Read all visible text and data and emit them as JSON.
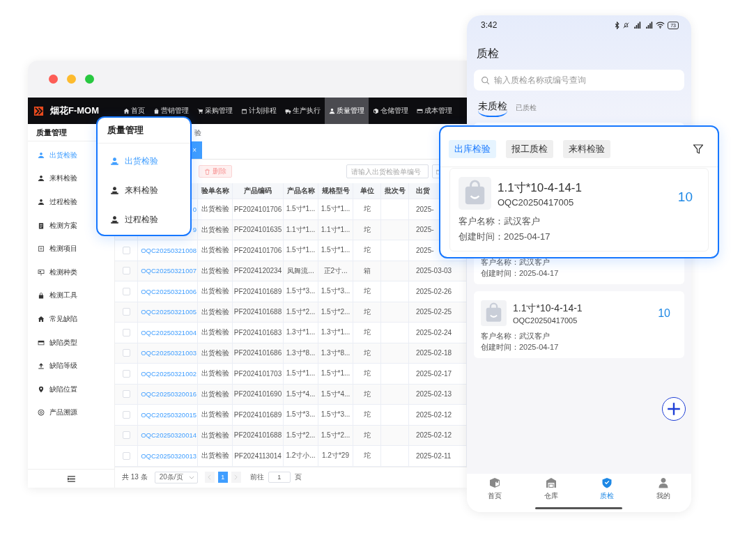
{
  "desktop": {
    "logo": "烟花F-MOM",
    "nav": [
      {
        "label": "首页",
        "kind": "home",
        "selected": false
      },
      {
        "label": "营销管理",
        "kind": "bag",
        "selected": false
      },
      {
        "label": "采购管理",
        "kind": "cart",
        "selected": false
      },
      {
        "label": "计划排程",
        "kind": "calendar",
        "selected": false
      },
      {
        "label": "生产执行",
        "kind": "truck",
        "selected": false
      },
      {
        "label": "质量管理",
        "kind": "user",
        "selected": true
      },
      {
        "label": "仓储管理",
        "kind": "box",
        "selected": false
      },
      {
        "label": "成本管理",
        "kind": "card",
        "selected": false
      }
    ],
    "sidebar": {
      "title": "质量管理",
      "items": [
        {
          "label": "出货检验",
          "kind": "user",
          "selected": true
        },
        {
          "label": "来料检验",
          "kind": "user",
          "selected": false
        },
        {
          "label": "过程检验",
          "kind": "user",
          "selected": false
        },
        {
          "label": "检测方案",
          "kind": "clipboard",
          "selected": false
        },
        {
          "label": "检测项目",
          "kind": "document",
          "selected": false
        },
        {
          "label": "检测种类",
          "kind": "easel",
          "selected": false
        },
        {
          "label": "检测工具",
          "kind": "lock",
          "selected": false
        },
        {
          "label": "常见缺陷",
          "kind": "home",
          "selected": false
        },
        {
          "label": "缺陷类型",
          "kind": "card",
          "selected": false
        },
        {
          "label": "缺陷等级",
          "kind": "upload",
          "selected": false
        },
        {
          "label": "缺陷位置",
          "kind": "pin",
          "selected": false
        },
        {
          "label": "产品溯源",
          "kind": "compass",
          "selected": false
        }
      ]
    },
    "breadcrumb": "验",
    "tabs": [
      {
        "close": "×",
        "selected": true
      }
    ],
    "toolbar": {
      "delete": "删除",
      "search_placeholder": "请输入出货检验单编号"
    },
    "table": {
      "columns": [
        "验单名称",
        "产品编码",
        "产品名称",
        "规格型号",
        "单位",
        "批次号",
        "出货"
      ],
      "rows": [
        {
          "code": "0",
          "name": "出货检验",
          "product_code": "PF2024101706",
          "product_name": "1.5寸*1...",
          "spec": "1.5寸*1...",
          "unit": "坨",
          "date": "2025-"
        },
        {
          "code": "9",
          "name": "出货检验",
          "product_code": "PF2024101635",
          "product_name": "1.1寸*1...",
          "spec": "1.1寸*1...",
          "unit": "坨",
          "date": "2025-"
        },
        {
          "checked": false,
          "code": "OQC20250321008",
          "name": "出货检验",
          "product_code": "PF2024101706",
          "product_name": "1.5寸*1...",
          "spec": "1.5寸*1...",
          "unit": "坨",
          "date": "2025-"
        },
        {
          "checked": false,
          "code": "OQC20250321007",
          "name": "出货检验",
          "product_code": "PF2024120234",
          "product_name": "凤舞流...",
          "spec": "正2寸...",
          "unit": "箱",
          "date": "2025-03-03"
        },
        {
          "checked": false,
          "code": "OQC20250321006",
          "name": "出货检验",
          "product_code": "PF2024101689",
          "product_name": "1.5寸*3...",
          "spec": "1.5寸*3...",
          "unit": "坨",
          "date": "2025-02-26"
        },
        {
          "checked": false,
          "code": "OQC20250321005",
          "name": "出货检验",
          "product_code": "PF2024101688",
          "product_name": "1.5寸*2...",
          "spec": "1.5寸*2...",
          "unit": "坨",
          "date": "2025-02-25"
        },
        {
          "checked": false,
          "code": "OQC20250321004",
          "name": "出货检验",
          "product_code": "PF2024101683",
          "product_name": "1.3寸*1...",
          "spec": "1.3寸*1...",
          "unit": "坨",
          "date": "2025-02-24"
        },
        {
          "checked": false,
          "code": "OQC20250321003",
          "name": "出货检验",
          "product_code": "PF2024101686",
          "product_name": "1.3寸*8...",
          "spec": "1.3寸*8...",
          "unit": "坨",
          "date": "2025-02-18"
        },
        {
          "checked": false,
          "code": "OQC20250321002",
          "name": "出货检验",
          "product_code": "PF2024101703",
          "product_name": "1.5寸*1...",
          "spec": "1.5寸*1...",
          "unit": "坨",
          "date": "2025-02-17"
        },
        {
          "checked": false,
          "code": "OQC20250320016",
          "name": "出货检验",
          "product_code": "PF2024101690",
          "product_name": "1.5寸*4...",
          "spec": "1.5寸*4...",
          "unit": "坨",
          "date": "2025-02-13"
        },
        {
          "checked": false,
          "code": "OQC20250320015",
          "name": "出货检验",
          "product_code": "PF2024101689",
          "product_name": "1.5寸*3...",
          "spec": "1.5寸*3...",
          "unit": "坨",
          "date": "2025-02-12"
        },
        {
          "checked": false,
          "code": "OQC20250320014",
          "name": "出货检验",
          "product_code": "PF2024101688",
          "product_name": "1.5寸*2...",
          "spec": "1.5寸*2...",
          "unit": "坨",
          "date": "2025-02-12"
        },
        {
          "checked": false,
          "code": "OQC20250320013",
          "name": "出货检验",
          "product_code": "PF2024113014",
          "product_name": "1.2寸小...",
          "spec": "1.2寸*29",
          "unit": "坨",
          "date": "2025-02-11"
        }
      ]
    },
    "pagination": {
      "total": "共 13 条",
      "page_size": "20条/页",
      "pages": [
        {
          "label": "1",
          "selected": true
        }
      ],
      "goto": "前往",
      "goto_value": "1",
      "goto_suffix": "页"
    }
  },
  "popup": {
    "title": "质量管理",
    "items": [
      {
        "label": "出货检验",
        "kind": "user",
        "selected": true
      },
      {
        "label": "来料检验",
        "kind": "user",
        "selected": false
      },
      {
        "label": "过程检验",
        "kind": "user",
        "selected": false
      }
    ]
  },
  "phone": {
    "time": "3:42",
    "battery": "73",
    "title": "质检",
    "search_placeholder": "输入质检名称或编号查询",
    "tabs": [
      {
        "label": "未质检",
        "selected": true
      },
      {
        "label": "已质检",
        "selected": false
      }
    ],
    "records": [
      {
        "customer_label": "客户名称：",
        "customer": "武汉客户",
        "time_label": "创建时间：",
        "time": "2025-04-17"
      },
      {
        "title": "1.1寸*10-4-14-1",
        "code": "OQC20250417005",
        "qty": "10",
        "customer_label": "客户名称：",
        "customer": "武汉客户",
        "time_label": "创建时间：",
        "time": "2025-04-17"
      }
    ],
    "nav": [
      {
        "label": "首页",
        "kind": "cube",
        "selected": false
      },
      {
        "label": "仓库",
        "kind": "warehouse",
        "selected": false
      },
      {
        "label": "质检",
        "kind": "shield",
        "selected": true
      },
      {
        "label": "我的",
        "kind": "person",
        "selected": false
      }
    ]
  },
  "phone_popup": {
    "chips": [
      {
        "label": "出库检验",
        "selected": true
      },
      {
        "label": "报工质检",
        "selected": false
      },
      {
        "label": "来料检验",
        "selected": false
      }
    ],
    "record": {
      "title": "1.1寸*10-4-14-1",
      "code": "OQC20250417005",
      "qty": "10",
      "customer_label": "客户名称：",
      "customer": "武汉客户",
      "time_label": "创建时间：",
      "time": "2025-04-17"
    }
  }
}
